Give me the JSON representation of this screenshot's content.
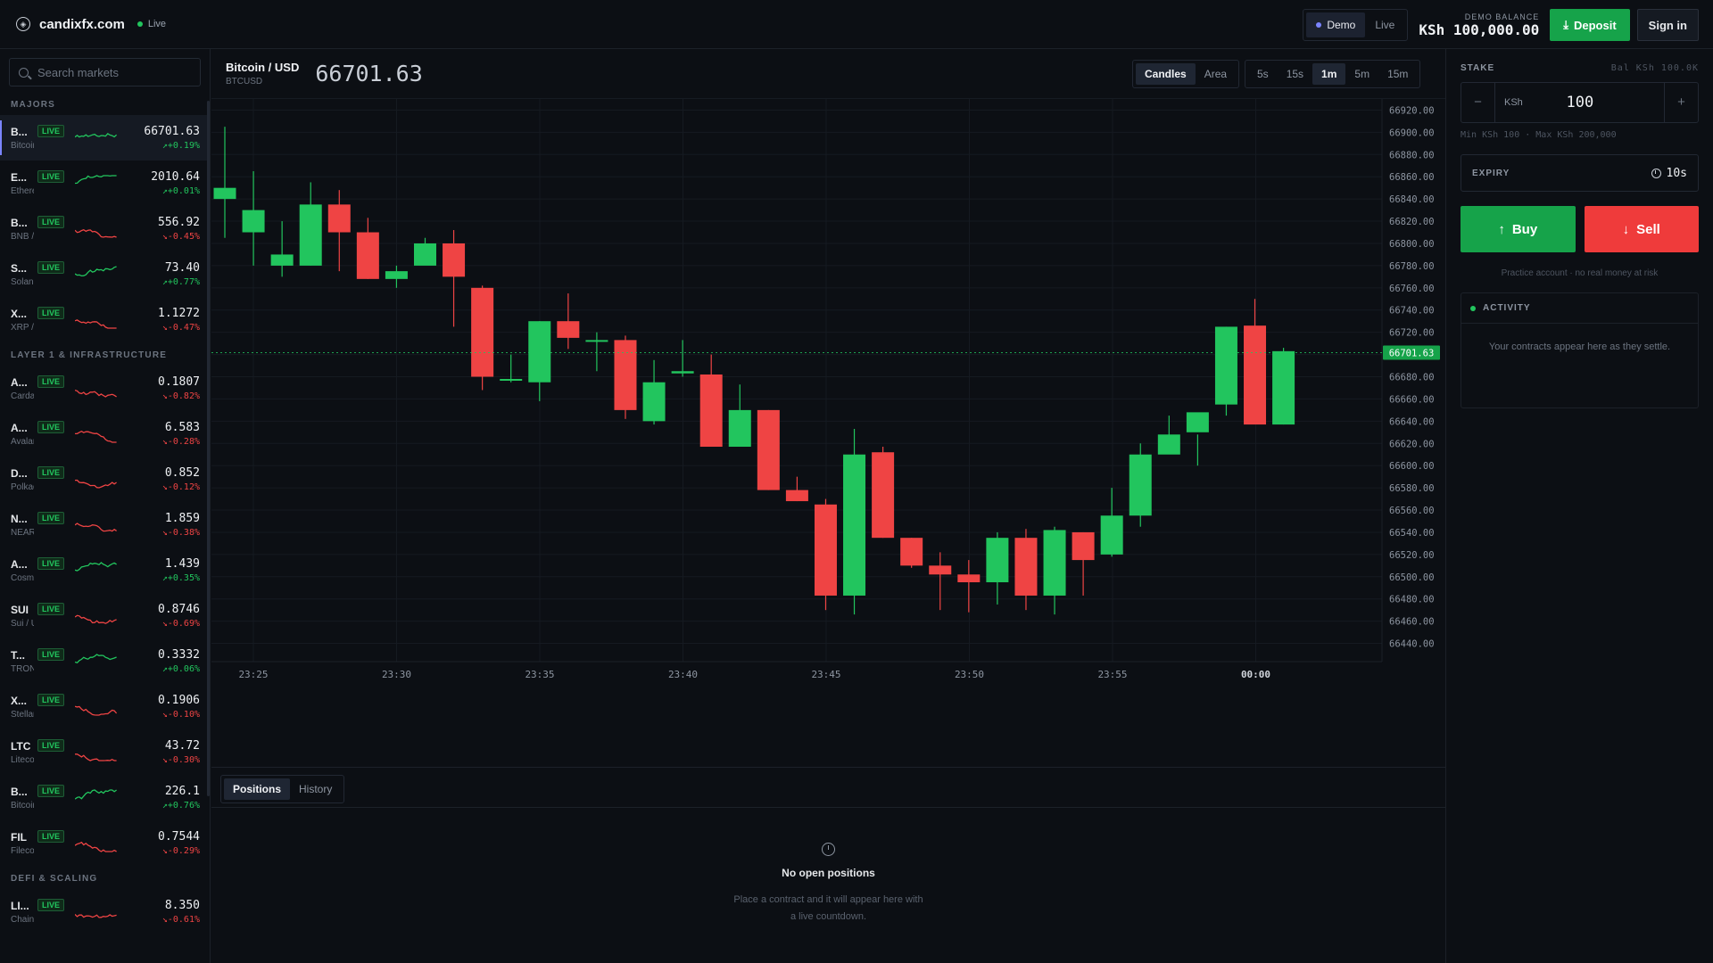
{
  "header": {
    "brand": "candixfx.com",
    "status": "Live",
    "modes": [
      "Demo",
      "Live"
    ],
    "active_mode": "Demo",
    "balance_label": "DEMO BALANCE",
    "balance_currency": "KSh",
    "balance_value": "100,000.00",
    "deposit_label": "Deposit",
    "signin_label": "Sign in"
  },
  "sidebar": {
    "search_placeholder": "Search markets",
    "groups": [
      {
        "title": "MAJORS",
        "items": [
          {
            "sym": "B...",
            "full": "Bitcoin / U...",
            "price": "66701.63",
            "change": "+0.19%",
            "dir": "up",
            "selected": true
          },
          {
            "sym": "E...",
            "full": "Ethereum ...",
            "price": "2010.64",
            "change": "+0.01%",
            "dir": "up"
          },
          {
            "sym": "B...",
            "full": "BNB / USD",
            "price": "556.92",
            "change": "-0.45%",
            "dir": "dn"
          },
          {
            "sym": "S...",
            "full": "Solana / U...",
            "price": "73.40",
            "change": "+0.77%",
            "dir": "up"
          },
          {
            "sym": "X...",
            "full": "XRP / USD",
            "price": "1.1272",
            "change": "-0.47%",
            "dir": "dn"
          }
        ]
      },
      {
        "title": "LAYER 1 & INFRASTRUCTURE",
        "items": [
          {
            "sym": "A...",
            "full": "Cardano / ...",
            "price": "0.1807",
            "change": "-0.82%",
            "dir": "dn"
          },
          {
            "sym": "A...",
            "full": "Avalanche ...",
            "price": "6.583",
            "change": "-0.28%",
            "dir": "dn"
          },
          {
            "sym": "D...",
            "full": "Polkadot / ...",
            "price": "0.852",
            "change": "-0.12%",
            "dir": "dn"
          },
          {
            "sym": "N...",
            "full": "NEAR / USD",
            "price": "1.859",
            "change": "-0.38%",
            "dir": "dn"
          },
          {
            "sym": "A...",
            "full": "Cosmos / ...",
            "price": "1.439",
            "change": "+0.35%",
            "dir": "up"
          },
          {
            "sym": "SUI",
            "full": "Sui / USD",
            "price": "0.8746",
            "change": "-0.69%",
            "dir": "dn"
          },
          {
            "sym": "T...",
            "full": "TRON / USD",
            "price": "0.3332",
            "change": "+0.06%",
            "dir": "up"
          },
          {
            "sym": "X...",
            "full": "Stellar / USD",
            "price": "0.1906",
            "change": "-0.10%",
            "dir": "dn"
          },
          {
            "sym": "LTC",
            "full": "Litecoin / ...",
            "price": "43.72",
            "change": "-0.30%",
            "dir": "dn"
          },
          {
            "sym": "B...",
            "full": "Bitcoin Ca...",
            "price": "226.1",
            "change": "+0.76%",
            "dir": "up"
          },
          {
            "sym": "FIL",
            "full": "Filecoin / ...",
            "price": "0.7544",
            "change": "-0.29%",
            "dir": "dn"
          }
        ]
      },
      {
        "title": "DEFI & SCALING",
        "items": [
          {
            "sym": "LI...",
            "full": "Chainlink / ...",
            "price": "8.350",
            "change": "-0.61%",
            "dir": "dn"
          }
        ]
      }
    ],
    "badge": "LIVE"
  },
  "chart_header": {
    "pair": "Bitcoin / USD",
    "ticker": "BTCUSD",
    "price": "66701.63",
    "type_options": [
      "Candles",
      "Area"
    ],
    "type_active": "Candles",
    "intervals": [
      "5s",
      "15s",
      "1m",
      "5m",
      "15m"
    ],
    "interval_active": "1m"
  },
  "chart_data": {
    "type": "candlestick",
    "ylim": [
      66430,
      66930
    ],
    "y_ticks": [
      "66920.00",
      "66900.00",
      "66880.00",
      "66860.00",
      "66840.00",
      "66820.00",
      "66800.00",
      "66780.00",
      "66760.00",
      "66740.00",
      "66720.00",
      "66700.00",
      "66680.00",
      "66660.00",
      "66640.00",
      "66620.00",
      "66600.00",
      "66580.00",
      "66560.00",
      "66540.00",
      "66520.00",
      "66500.00",
      "66480.00",
      "66460.00",
      "66440.00"
    ],
    "x_ticks": [
      "23:25",
      "23:30",
      "23:35",
      "23:40",
      "23:45",
      "23:50",
      "23:55",
      "00:00"
    ],
    "last_price": "66701.63",
    "candles": [
      [
        66840,
        66905,
        66850,
        66805
      ],
      [
        66810,
        66865,
        66830,
        66780
      ],
      [
        66780,
        66820,
        66790,
        66770
      ],
      [
        66780,
        66855,
        66835,
        66780
      ],
      [
        66835,
        66848,
        66810,
        66775
      ],
      [
        66810,
        66823,
        66768,
        66768
      ],
      [
        66768,
        66780,
        66775,
        66760
      ],
      [
        66780,
        66805,
        66800,
        66795
      ],
      [
        66800,
        66812,
        66770,
        66725
      ],
      [
        66760,
        66762,
        66680,
        66668
      ],
      [
        66678,
        66700,
        66678,
        66675
      ],
      [
        66675,
        66730,
        66730,
        66658
      ],
      [
        66730,
        66755,
        66715,
        66705
      ],
      [
        66712,
        66720,
        66713,
        66685
      ],
      [
        66713,
        66717,
        66650,
        66642
      ],
      [
        66640,
        66695,
        66675,
        66637
      ],
      [
        66683,
        66713,
        66685,
        66680
      ],
      [
        66682,
        66700,
        66617,
        66617
      ],
      [
        66617,
        66673,
        66650,
        66617
      ],
      [
        66650,
        66650,
        66578,
        66578
      ],
      [
        66578,
        66590,
        66568,
        66568
      ],
      [
        66565,
        66570,
        66483,
        66470
      ],
      [
        66483,
        66633,
        66610,
        66466
      ],
      [
        66612,
        66617,
        66535,
        66535
      ],
      [
        66535,
        66535,
        66510,
        66508
      ],
      [
        66510,
        66522,
        66502,
        66470
      ],
      [
        66502,
        66515,
        66495,
        66468
      ],
      [
        66495,
        66540,
        66535,
        66475
      ],
      [
        66535,
        66543,
        66483,
        66470
      ],
      [
        66483,
        66545,
        66542,
        66466
      ],
      [
        66540,
        66540,
        66515,
        66483
      ],
      [
        66520,
        66580,
        66555,
        66518
      ],
      [
        66555,
        66620,
        66610,
        66545
      ],
      [
        66610,
        66645,
        66628,
        66618
      ],
      [
        66630,
        66628,
        66648,
        66600
      ],
      [
        66655,
        66725,
        66725,
        66645
      ],
      [
        66726,
        66750,
        66637,
        66640
      ],
      [
        66637,
        66706,
        66703,
        66637
      ]
    ]
  },
  "bottom": {
    "tabs": [
      "Positions",
      "History"
    ],
    "active_tab": "Positions",
    "empty_title": "No open positions",
    "empty_line1": "Place a contract and it will appear here with",
    "empty_line2": "a live countdown."
  },
  "panel": {
    "stake_label": "STAKE",
    "bal_hint": "Bal KSh 100.0K",
    "stake_currency": "KSh",
    "stake_value": "100",
    "minus": "−",
    "plus": "+",
    "minmax": "Min KSh 100 · Max KSh 200,000",
    "expiry_label": "EXPIRY",
    "expiry_value": "10s",
    "buy_label": "Buy",
    "sell_label": "Sell",
    "note": "Practice account · no real money at risk",
    "activity_title": "ACTIVITY",
    "activity_empty": "Your contracts appear here as they settle."
  },
  "colors": {
    "up": "#22c55e",
    "down": "#ef4444",
    "accent": "#7b84ff"
  }
}
